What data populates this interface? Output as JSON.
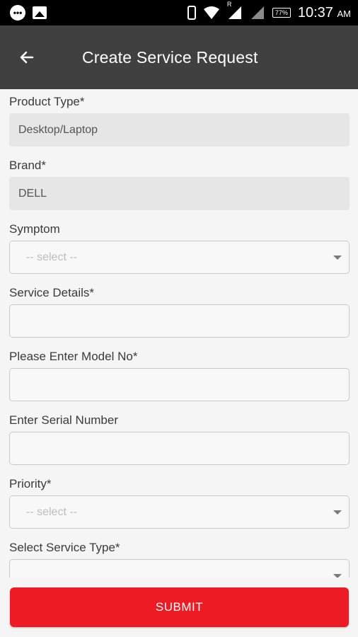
{
  "status_bar": {
    "icons_left": [
      "chat-bubble-icon",
      "gallery-icon"
    ],
    "icons_right": [
      "phone-icon",
      "wifi-icon",
      "signal-icon",
      "signal-icon-2"
    ],
    "signal_marker": "R",
    "battery": "77%",
    "time": "10:37",
    "ampm": "AM"
  },
  "app_bar": {
    "title": "Create Service Request",
    "back_icon": "arrow-left-icon"
  },
  "form": {
    "product_type": {
      "label": "Product Type*",
      "value": "Desktop/Laptop"
    },
    "brand": {
      "label": "Brand*",
      "value": "DELL"
    },
    "symptom": {
      "label": "Symptom",
      "selected": "-- select --"
    },
    "service_details": {
      "label": "Service Details*",
      "value": ""
    },
    "model_no": {
      "label": "Please Enter Model No*",
      "value": ""
    },
    "serial_number": {
      "label": "Enter Serial Number",
      "value": ""
    },
    "priority": {
      "label": "Priority*",
      "selected": "-- select --"
    },
    "service_type": {
      "label": "Select Service Type*",
      "selected": ""
    }
  },
  "submit": {
    "label": "SUBMIT"
  },
  "colors": {
    "app_bar": "#404040",
    "submit": "#ed1c24",
    "background": "#f5f5f5"
  }
}
